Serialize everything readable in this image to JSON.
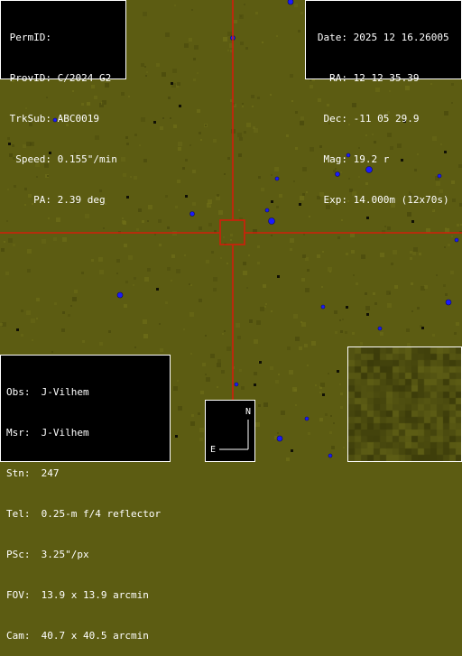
{
  "tracking": {
    "permid_label": "PermID:",
    "permid_value": "",
    "provid_label": "ProvID:",
    "provid_value": "C/2024 G2",
    "trksub_label": "TrkSub:",
    "trksub_value": "ABC0019",
    "speed_label": "Speed:",
    "speed_value": "0.155\"/min",
    "pa_label": "PA:",
    "pa_value": "2.39 deg"
  },
  "observation": {
    "date_label": "Date:",
    "date_value": "2025 12 16.26005",
    "ra_label": "RA:",
    "ra_value": "12 12 35.39",
    "dec_label": "Dec:",
    "dec_value": "-11 05 29.9",
    "mag_label": "Mag:",
    "mag_value": "19.2 r",
    "exp_label": "Exp:",
    "exp_value": "14.000m (12x70s)"
  },
  "station": {
    "obs_label": "Obs:",
    "obs_value": "J-Vilhem",
    "msr_label": "Msr:",
    "msr_value": "J-Vilhem",
    "stn_label": "Stn:",
    "stn_value": "247",
    "tel_label": "Tel:",
    "tel_value": "0.25-m f/4 reflector",
    "psc_label": "PSc:",
    "psc_value": "3.25\"/px",
    "fov_label": "FOV:",
    "fov_value": "13.9 x 13.9 arcmin",
    "cam_label": "Cam:",
    "cam_value": "40.7 x 40.5 arcmin"
  },
  "compass": {
    "north": "N",
    "east": "E"
  },
  "colors": {
    "sky": "#5c5c12",
    "crosshair": "#d21e0a",
    "star_saturated": "#1a1aff",
    "dark_pixel": "#101005",
    "panel_bg": "#000000",
    "panel_border": "#ffffff",
    "panel_text": "#ffffff"
  }
}
